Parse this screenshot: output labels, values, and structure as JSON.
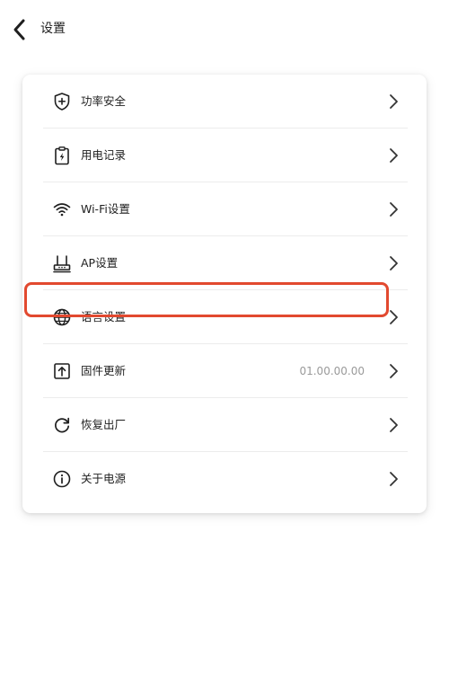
{
  "header": {
    "title": "设置",
    "back_icon": "chevron-left-icon"
  },
  "menu": {
    "items": [
      {
        "key": "power-safety",
        "label": "功率安全",
        "icon": "shield-plus-icon",
        "value": ""
      },
      {
        "key": "power-records",
        "label": "用电记录",
        "icon": "clipboard-bolt-icon",
        "value": ""
      },
      {
        "key": "wifi-settings",
        "label": "Wi-Fi设置",
        "icon": "wifi-icon",
        "value": ""
      },
      {
        "key": "ap-settings",
        "label": "AP设置",
        "icon": "router-icon",
        "value": ""
      },
      {
        "key": "language-settings",
        "label": "语言设置",
        "icon": "globe-icon",
        "value": ""
      },
      {
        "key": "firmware-update",
        "label": "固件更新",
        "icon": "upload-box-icon",
        "value": "01.00.00.00"
      },
      {
        "key": "factory-reset",
        "label": "恢复出厂",
        "icon": "refresh-icon",
        "value": ""
      },
      {
        "key": "about-power",
        "label": "关于电源",
        "icon": "info-icon",
        "value": ""
      }
    ],
    "highlighted_item": "firmware-update",
    "highlight_color": "#e2492f"
  }
}
